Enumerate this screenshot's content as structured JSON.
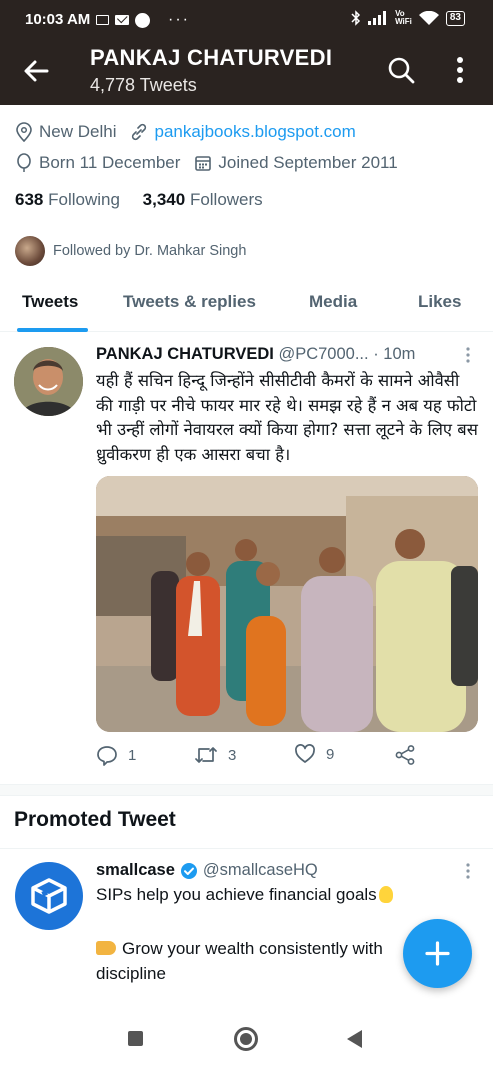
{
  "status_bar": {
    "time": "10:03 AM",
    "more": "···",
    "network": "Vo\nWiFi",
    "battery": "83"
  },
  "header": {
    "name": "PANKAJ CHATURVEDI",
    "tweet_count": "4,778 Tweets"
  },
  "profile": {
    "location": "New Delhi",
    "website": "pankajbooks.blogspot.com",
    "born": "Born 11 December",
    "joined": "Joined September 2011",
    "following_count": "638",
    "following_label": "Following",
    "followers_count": "3,340",
    "followers_label": "Followers",
    "followed_by": "Followed by Dr. Mahkar Singh"
  },
  "tabs": [
    {
      "label": "Tweets",
      "active": true
    },
    {
      "label": "Tweets & replies",
      "active": false
    },
    {
      "label": "Media",
      "active": false
    },
    {
      "label": "Likes",
      "active": false
    }
  ],
  "tweet": {
    "name": "PANKAJ CHATURVEDI",
    "handle": "@PC7000...",
    "time": "· 10m",
    "text": "यही हैं सचिन हिन्दू जिन्होंने सीसीटीवी कैमरों के  सामने ओवैसी की गाड़ी पर नीचे फायर मार रहे थे। समझ रहे हैं न अब यह फोटो भी उन्हीं लोगों नेवायरल क्यों किया होगा? सत्ता लूटने के लिए बस ध्रुवीकरण ही एक आसरा बचा है।",
    "replies": "1",
    "retweets": "3",
    "likes": "9"
  },
  "promoted": {
    "title": "Promoted Tweet",
    "name": "smallcase",
    "handle": "@smallcaseHQ",
    "line1": "SIPs help you achieve financial goals",
    "line2": "Grow your wealth consistently with discipline"
  },
  "colors": {
    "accent": "#1d9bf0",
    "header_bg": "#2a2320",
    "muted_text": "#536471"
  },
  "icons": [
    "back-arrow-icon",
    "search-icon",
    "more-vertical-icon",
    "location-icon",
    "link-icon",
    "balloon-icon",
    "calendar-icon",
    "reply-icon",
    "retweet-icon",
    "like-icon",
    "share-icon",
    "verified-icon",
    "compose-plus-icon"
  ]
}
